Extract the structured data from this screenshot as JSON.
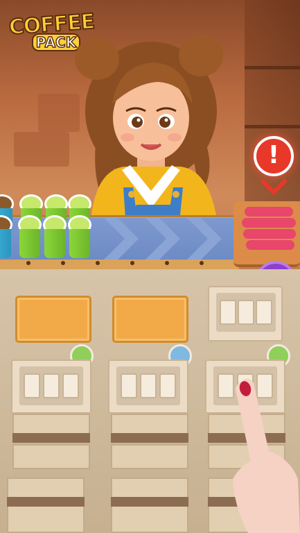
{
  "logo": {
    "line1": "COFFEE",
    "line2": "PACK"
  },
  "alert": {
    "symbol": "!",
    "color": "#e8382a"
  },
  "conveyor": {
    "cups": [
      {
        "type": "brown"
      },
      {
        "type": "green"
      },
      {
        "type": "green"
      },
      {
        "type": "green"
      },
      {
        "type": "brown"
      },
      {
        "type": "green"
      },
      {
        "type": "green"
      },
      {
        "type": "green"
      }
    ]
  },
  "order_bubble": {
    "icon": "coffee-cup-icon",
    "color": "#8e3fcf"
  },
  "boxes": {
    "columns": [
      {
        "top": "closed-lid",
        "indicator_color": "#8fcf5a"
      },
      {
        "top": "closed-lid",
        "indicator_color": "#7fb8e0"
      },
      {
        "top": "open-empty",
        "indicator_color": "#8fcf5a"
      }
    ]
  },
  "colors": {
    "belt": "#6d8bc4",
    "lid": "#f2aa48",
    "green_cup": "#8cd63a"
  }
}
